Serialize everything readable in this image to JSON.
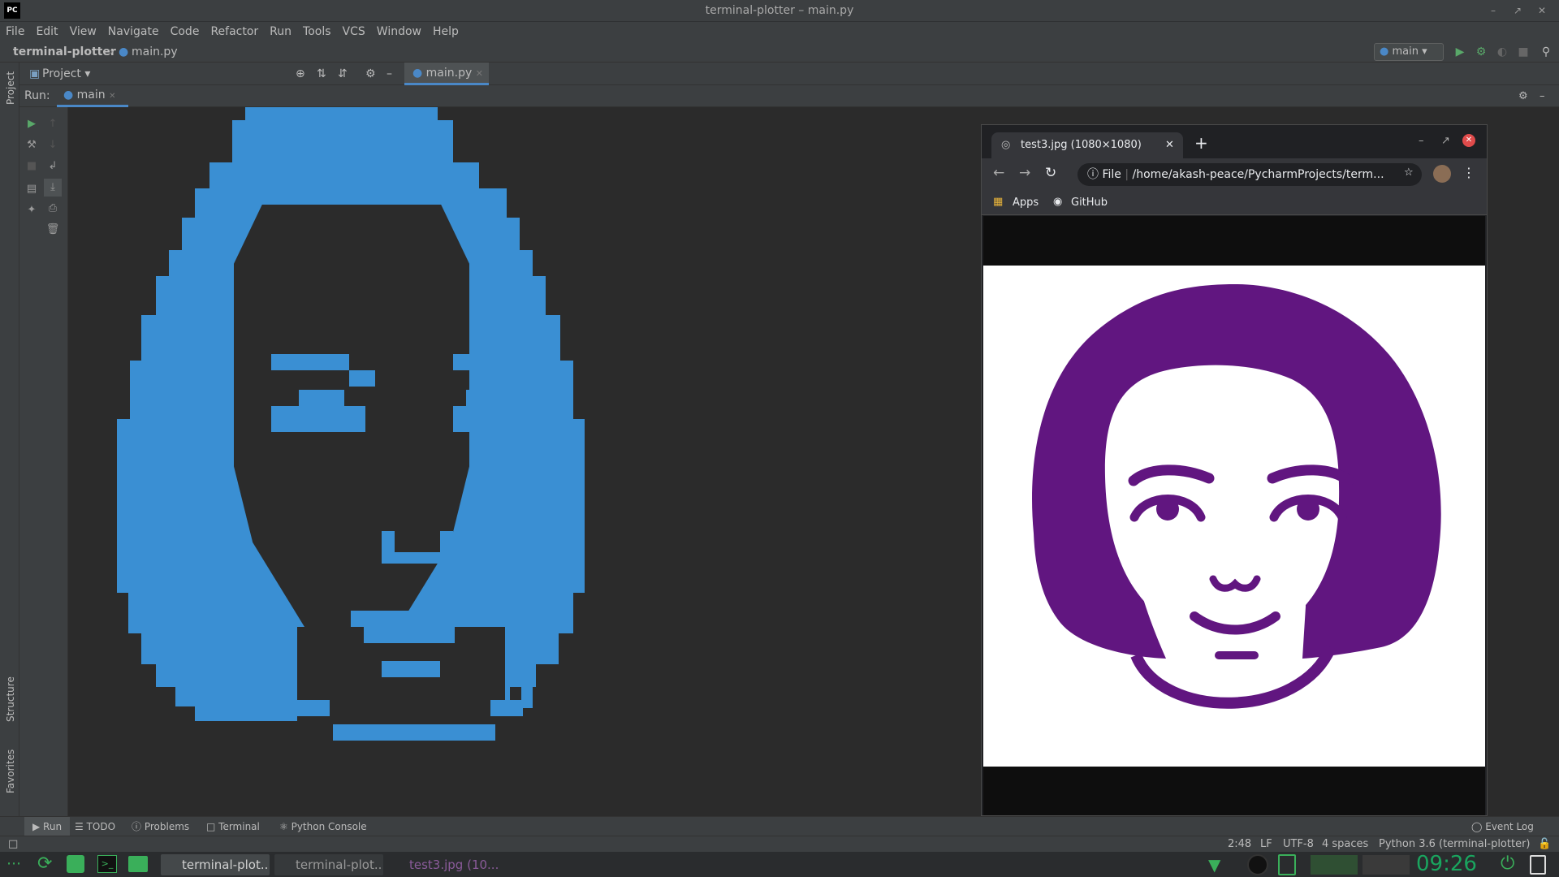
{
  "window": {
    "title": "terminal-plotter – main.py",
    "app_icon": "PC"
  },
  "menu": [
    "File",
    "Edit",
    "View",
    "Navigate",
    "Code",
    "Refactor",
    "Run",
    "Tools",
    "VCS",
    "Window",
    "Help"
  ],
  "breadcrumb": {
    "project": "terminal-plotter",
    "file": "main.py"
  },
  "run_config": "main",
  "project_panel": {
    "label": "Project"
  },
  "editor_tab": "main.py",
  "run_panel": {
    "label": "Run:",
    "tab": "main"
  },
  "side_labels": {
    "project": "Project",
    "structure": "Structure",
    "favorites": "Favorites"
  },
  "browser": {
    "tab_title": "test3.jpg (1080×1080)",
    "url_prefix": "File",
    "url": "/home/akash-peace/PycharmProjects/term...",
    "bookmarks": [
      "Apps",
      "GitHub"
    ]
  },
  "bottom_tabs": [
    "Run",
    "TODO",
    "Problems",
    "Terminal",
    "Python Console"
  ],
  "event_log": "Event Log",
  "status": {
    "position": "2:48",
    "line_sep": "LF",
    "encoding": "UTF-8",
    "indent": "4 spaces",
    "interpreter": "Python 3.6 (terminal-plotter)"
  },
  "taskbar": {
    "items": [
      "terminal-plot...",
      "terminal-plot...",
      "test3.jpg (10..."
    ],
    "clock": "09:26",
    "clock_color": "#1aa55f"
  },
  "colors": {
    "pixel_blue": "#3a8fd3",
    "hair_purple": "#611680",
    "accent": "#4a88c7"
  }
}
